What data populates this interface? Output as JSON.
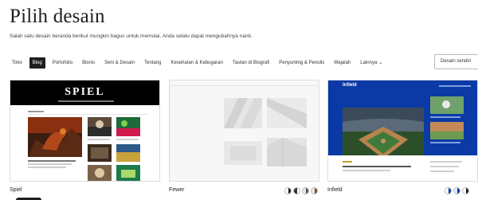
{
  "page": {
    "title": "Pilih desain",
    "subtitle": "Salah satu desain beranda berikut mungkin bagus untuk memulai. Anda selalu dapat mengubahnya nanti."
  },
  "filters": [
    {
      "label": "Toko",
      "active": false
    },
    {
      "label": "Blog",
      "active": true
    },
    {
      "label": "Portofolio",
      "active": false
    },
    {
      "label": "Bisnis",
      "active": false
    },
    {
      "label": "Seni & Desain",
      "active": false
    },
    {
      "label": "Tentang",
      "active": false
    },
    {
      "label": "Kesehatan & Kebugaran",
      "active": false
    },
    {
      "label": "Tautan di Biografi",
      "active": false
    },
    {
      "label": "Penyunting & Penulis",
      "active": false
    },
    {
      "label": "Majalah",
      "active": false
    },
    {
      "label": "Lainnya",
      "active": false,
      "icon": "chevron-down-icon"
    }
  ],
  "custom_button": "Desain sendiri",
  "designs": [
    {
      "name": "Spiel",
      "preview_logo": "SPIEL",
      "style_colors": []
    },
    {
      "name": "Fewer",
      "style_colors": [
        [
          "#ffffff",
          "#1e1e1e"
        ],
        [
          "#333333",
          "#ffffff"
        ],
        [
          "#e8e8e8",
          "#555555"
        ],
        [
          "#f4e6d6",
          "#7a4a2a"
        ]
      ]
    },
    {
      "name": "Infield",
      "preview_logo": "Infield",
      "style_colors": [
        [
          "#ffffff",
          "#0b3aa6"
        ],
        [
          "#e6edf9",
          "#0b3aa6"
        ],
        [
          "#ffffff",
          "#1e1e1e"
        ]
      ]
    }
  ],
  "colors": {
    "accent": "#1e1e1e",
    "infield_blue": "#0b3aa6",
    "spiel_black": "#000000"
  }
}
